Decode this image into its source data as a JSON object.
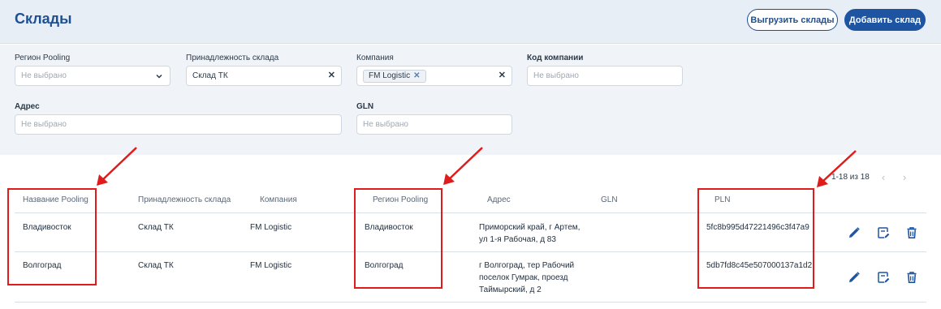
{
  "header": {
    "title": "Склады",
    "export_label": "Выгрузить склады",
    "add_label": "Добавить склад"
  },
  "filters": {
    "region": {
      "label": "Регион Pooling",
      "placeholder": "Не выбрано"
    },
    "ownership": {
      "label": "Принадлежность склада",
      "value": "Склад ТК"
    },
    "company": {
      "label": "Компания",
      "chip": "FM Logistic"
    },
    "company_code": {
      "label": "Код компании",
      "placeholder": "Не выбрано"
    },
    "address": {
      "label": "Адрес",
      "placeholder": "Не выбрано"
    },
    "gln": {
      "label": "GLN",
      "placeholder": "Не выбрано"
    }
  },
  "pagination": {
    "text": "1-18 из 18"
  },
  "table": {
    "columns": [
      "Название Pooling",
      "Принадлежность склада",
      "Компания",
      "Регион Pooling",
      "Адрес",
      "GLN",
      "PLN"
    ],
    "rows": [
      {
        "name": "Владивосток",
        "ownership": "Склад ТК",
        "company": "FM Logistic",
        "region": "Владивосток",
        "address": [
          "Приморский край, г Артем,",
          "ул 1-я Рабочая, д 83"
        ],
        "gln": "",
        "pln": "5fc8b995d47221496c3f47a9"
      },
      {
        "name": "Волгоград",
        "ownership": "Склад ТК",
        "company": "FM Logistic",
        "region": "Волгоград",
        "address": [
          "г Волгоград, тер Рабочий",
          "поселок Гумрак, проезд",
          "Таймырский, д 2"
        ],
        "gln": "",
        "pln": "5db7fd8c45e507000137a1d2"
      }
    ]
  },
  "icons": {
    "edit": "pencil-icon",
    "edit_doc": "edit-document-icon",
    "delete": "trash-icon"
  },
  "colors": {
    "brand": "#1e55a3",
    "header_bg": "#e8eef5",
    "annotation": "#e01b1b"
  }
}
